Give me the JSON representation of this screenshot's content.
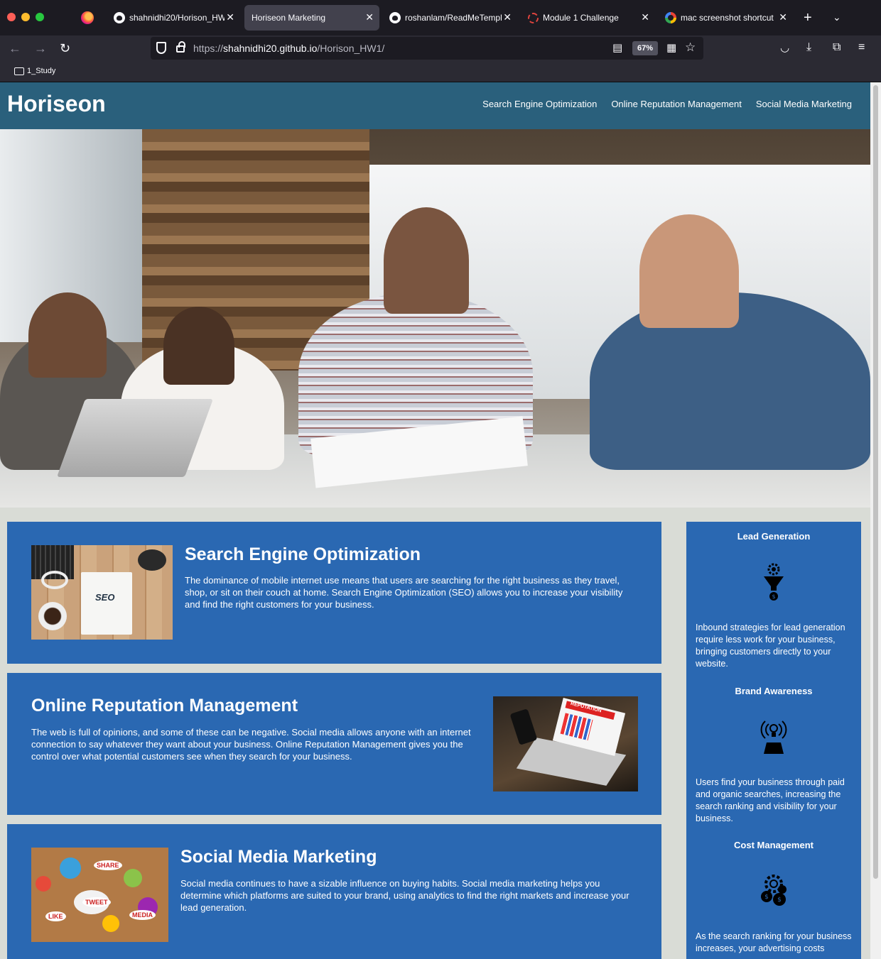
{
  "browser": {
    "tabs": [
      {
        "title": "shahnidhi20/Horison_HW1",
        "favicon": "github-icon",
        "active": false
      },
      {
        "title": "Horiseon Marketing",
        "favicon": "none",
        "active": true
      },
      {
        "title": "roshanlam/ReadMeTemplate",
        "favicon": "github-icon",
        "active": false
      },
      {
        "title": "Module 1 Challenge",
        "favicon": "canvas-icon",
        "active": false
      },
      {
        "title": "mac screenshot shortcut",
        "favicon": "google-icon",
        "active": false
      }
    ],
    "url_prefix": "https://",
    "url_host": "shahnidhi20.github.io",
    "url_path": "/Horison_HW1/",
    "zoom": "67%",
    "bookmark": "1_Study"
  },
  "site": {
    "logo": "Horiseon",
    "nav": [
      "Search Engine Optimization",
      "Online Reputation Management",
      "Social Media Marketing"
    ],
    "sections": [
      {
        "title": "Search Engine Optimization",
        "text": "The dominance of mobile internet use means that users are searching for the right business as they travel, shop, or sit on their couch at home. Search Engine Optimization (SEO) allows you to increase your visibility and find the right customers for your business."
      },
      {
        "title": "Online Reputation Management",
        "text": "The web is full of opinions, and some of these can be negative. Social media allows anyone with an internet connection to say whatever they want about your business. Online Reputation Management gives you the control over what potential customers see when they search for your business."
      },
      {
        "title": "Social Media Marketing",
        "text": "Social media continues to have a sizable influence on buying habits. Social media marketing helps you determine which platforms are suited to your brand, using analytics to find the right markets and increase your lead generation."
      }
    ],
    "benefits": [
      {
        "title": "Lead Generation",
        "icon": "lead-generation-icon",
        "text": "Inbound strategies for lead generation require less work for your business, bringing customers directly to your website."
      },
      {
        "title": "Brand Awareness",
        "icon": "brand-awareness-icon",
        "text": "Users find your business through paid and organic searches, increasing the search ranking and visibility for your business."
      },
      {
        "title": "Cost Management",
        "icon": "cost-management-icon",
        "text": "As the search ranking for your business increases, your advertising costs"
      }
    ],
    "image_labels": {
      "seo": "SEO",
      "reputation": "REPUTATION",
      "smm_tags": [
        "SHARE",
        "TWEET",
        "LIKE",
        "MEDIA"
      ]
    }
  },
  "colors": {
    "header": "#2a607c",
    "card": "#2a68b2",
    "page_bg": "#d9dcd6"
  }
}
